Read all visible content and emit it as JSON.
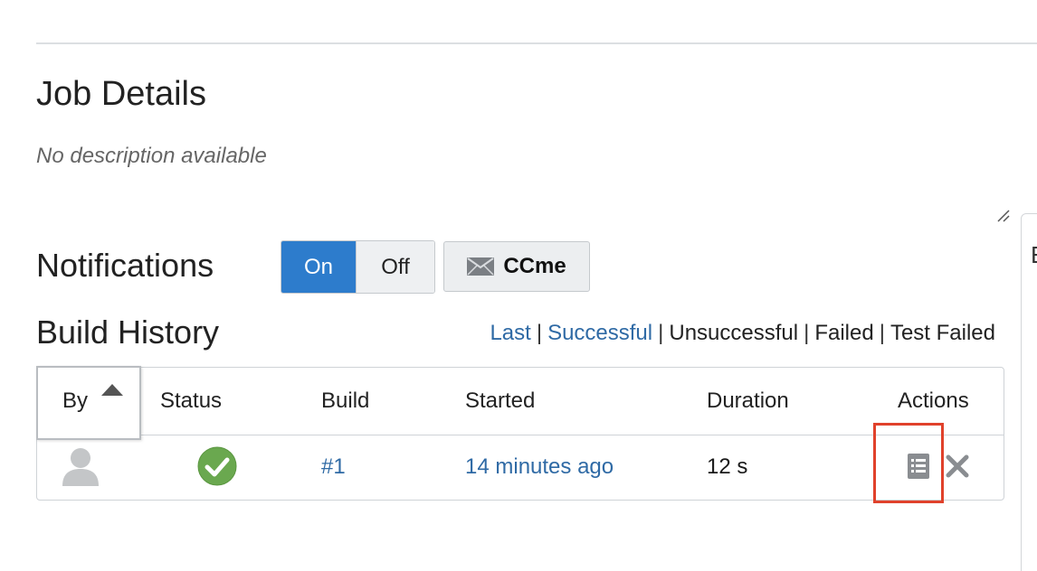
{
  "job": {
    "title": "Job Details",
    "description": "No description available"
  },
  "notifications": {
    "label": "Notifications",
    "on_label": "On",
    "off_label": "Off",
    "selected": "On",
    "ccme_label": "CCme"
  },
  "build_history": {
    "label": "Build History",
    "filters": {
      "last": "Last",
      "successful": "Successful",
      "unsuccessful": "Unsuccessful",
      "failed": "Failed",
      "test_failed": "Test Failed",
      "separator": "|"
    },
    "columns": {
      "by": "By",
      "status": "Status",
      "build": "Build",
      "started": "Started",
      "duration": "Duration",
      "actions": "Actions"
    },
    "rows": [
      {
        "by_icon": "user-avatar-icon",
        "status_icon": "success-check-icon",
        "build": "#1",
        "started": "14 minutes ago",
        "duration": "12 s",
        "actions": [
          "view-log-icon",
          "delete-icon"
        ]
      }
    ]
  },
  "side_panel": {
    "letter": "E"
  },
  "colors": {
    "accent": "#2d7ccc",
    "link": "#2f6aa5",
    "success": "#6aa84f",
    "highlight": "#e0412b"
  }
}
